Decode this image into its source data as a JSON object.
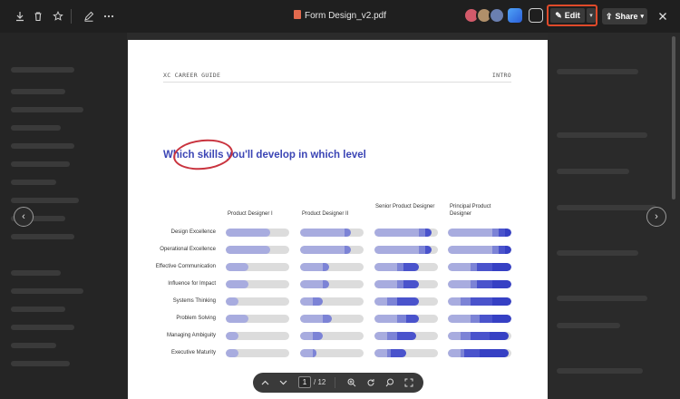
{
  "toolbar": {
    "file_name": "Form Design_v2.pdf",
    "edit_label": "Edit",
    "share_label": "Share",
    "left_icons": [
      "download-icon",
      "delete-icon",
      "favorite-icon",
      "annotate-icon",
      "more-icon"
    ],
    "avatars": [
      "#d35a6a",
      "#b08f6a",
      "#6a7fb0"
    ]
  },
  "document": {
    "header_left": "XC CAREER GUIDE",
    "header_right": "INTRO",
    "title": "Which skills you'll develop in which level",
    "columns": [
      "Product Designer I",
      "Product Designer II",
      "Senior Product Designer",
      "Principal Product Designer"
    ],
    "skills": [
      {
        "label": "Design Excellence",
        "levels": [
          0.7,
          0.8,
          0.9,
          1.0
        ]
      },
      {
        "label": "Operational Excellence",
        "levels": [
          0.7,
          0.8,
          0.9,
          1.0
        ]
      },
      {
        "label": "Effective Communication",
        "levels": [
          0.35,
          0.45,
          0.7,
          1.0
        ]
      },
      {
        "label": "Influence for Impact",
        "levels": [
          0.35,
          0.45,
          0.7,
          1.0
        ]
      },
      {
        "label": "Systems Thinking",
        "levels": [
          0.2,
          0.35,
          0.7,
          1.0
        ]
      },
      {
        "label": "Problem Solving",
        "levels": [
          0.35,
          0.5,
          0.7,
          1.0
        ]
      },
      {
        "label": "Managing Ambiguity",
        "levels": [
          0.2,
          0.35,
          0.65,
          0.95
        ]
      },
      {
        "label": "Executive Maturity",
        "levels": [
          0.2,
          0.25,
          0.5,
          0.95
        ]
      }
    ],
    "colors": {
      "light": "#a8acdf",
      "mid": "#7c83d6",
      "dark": "#4a53cc",
      "darkest": "#3640c4",
      "track": "#dcdcdc",
      "title": "#3b45b5",
      "annotation": "#c9333e"
    }
  },
  "pager": {
    "current_page": "1",
    "total": "/ 12"
  }
}
